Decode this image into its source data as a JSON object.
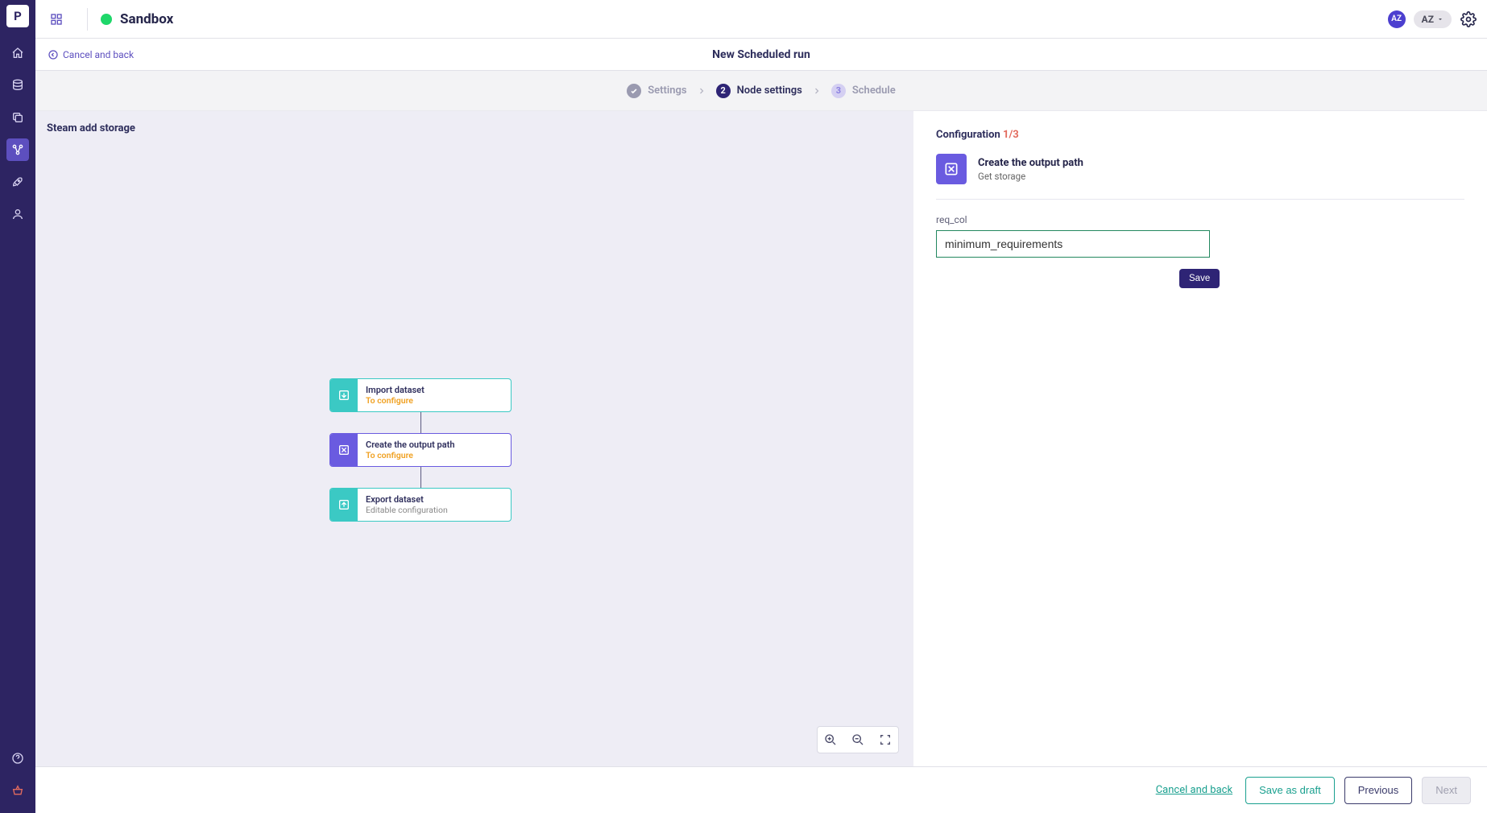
{
  "brand_initial": "P",
  "topbar": {
    "env_name": "Sandbox",
    "avatar_initials": "AZ",
    "user_label": "AZ"
  },
  "subheader": {
    "cancel_label": "Cancel and back",
    "page_title": "New Scheduled run"
  },
  "stepper": {
    "step1": "Settings",
    "step2": "Node settings",
    "step3": "Schedule",
    "active_index": 2
  },
  "main": {
    "title": "Steam add storage",
    "nodes": [
      {
        "title": "Import dataset",
        "subtitle": "To configure",
        "sub_warn": true,
        "variant": "teal"
      },
      {
        "title": "Create the output path",
        "subtitle": "To configure",
        "sub_warn": true,
        "variant": "purple"
      },
      {
        "title": "Export dataset",
        "subtitle": "Editable configuration",
        "sub_warn": false,
        "variant": "teal"
      }
    ]
  },
  "config": {
    "heading_label": "Configuration",
    "heading_count": "1/3",
    "card_title": "Create the output path",
    "card_subtitle": "Get storage",
    "field_label": "req_col",
    "field_value": "minimum_requirements",
    "save_label": "Save"
  },
  "footer": {
    "cancel_link": "Cancel and back",
    "draft_label": "Save as draft",
    "prev_label": "Previous",
    "next_label": "Next"
  }
}
